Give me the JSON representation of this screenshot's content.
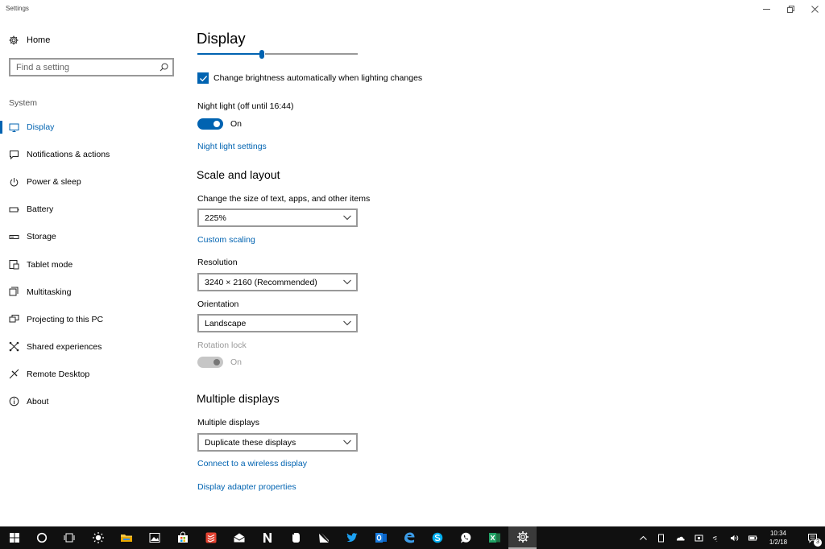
{
  "window": {
    "title": "Settings",
    "minimize": "—",
    "restore": "❐",
    "close": "✕"
  },
  "sidebar": {
    "home_label": "Home",
    "search_placeholder": "Find a setting",
    "section_label": "System",
    "items": [
      {
        "label": "Display",
        "icon": "monitor-icon",
        "active": true
      },
      {
        "label": "Notifications & actions",
        "icon": "message-icon"
      },
      {
        "label": "Power & sleep",
        "icon": "power-icon"
      },
      {
        "label": "Battery",
        "icon": "battery-icon"
      },
      {
        "label": "Storage",
        "icon": "storage-icon"
      },
      {
        "label": "Tablet mode",
        "icon": "tablet-icon"
      },
      {
        "label": "Multitasking",
        "icon": "multitask-icon"
      },
      {
        "label": "Projecting to this PC",
        "icon": "project-icon"
      },
      {
        "label": "Shared experiences",
        "icon": "shared-icon"
      },
      {
        "label": "Remote Desktop",
        "icon": "remote-icon"
      },
      {
        "label": "About",
        "icon": "info-icon"
      }
    ]
  },
  "main": {
    "title": "Display",
    "brightness_level": 0.4,
    "auto_brightness_label": "Change brightness automatically when lighting changes",
    "auto_brightness_checked": true,
    "night_light_label": "Night light (off until 16:44)",
    "night_light_state": "On",
    "night_light_settings_link": "Night light settings",
    "scale_heading": "Scale and layout",
    "scale_label": "Change the size of text, apps, and other items",
    "scale_value": "225%",
    "custom_scaling_link": "Custom scaling",
    "resolution_label": "Resolution",
    "resolution_value": "3240 × 2160 (Recommended)",
    "orientation_label": "Orientation",
    "orientation_value": "Landscape",
    "rotation_lock_label": "Rotation lock",
    "rotation_lock_state": "On",
    "multiple_heading": "Multiple displays",
    "multiple_label": "Multiple displays",
    "multiple_value": "Duplicate these displays",
    "wireless_link": "Connect to a wireless display",
    "adapter_link": "Display adapter properties"
  },
  "taskbar": {
    "apps": [
      "start-icon",
      "cortana-icon",
      "task-view-icon",
      "weather-icon",
      "file-explorer-icon",
      "photos-icon",
      "store-icon",
      "todoist-icon",
      "mail-icon",
      "onenote-icon",
      "evernote-icon",
      "flipboard-icon",
      "twitter-icon",
      "outlook-icon",
      "edge-icon",
      "skype-icon",
      "whatsapp-icon",
      "excel-icon",
      "settings-icon"
    ],
    "time": "10:34",
    "date": "1/2/18",
    "notification_count": "3",
    "colors": {
      "accent": "#0063b1",
      "taskbar": "#101010"
    }
  }
}
